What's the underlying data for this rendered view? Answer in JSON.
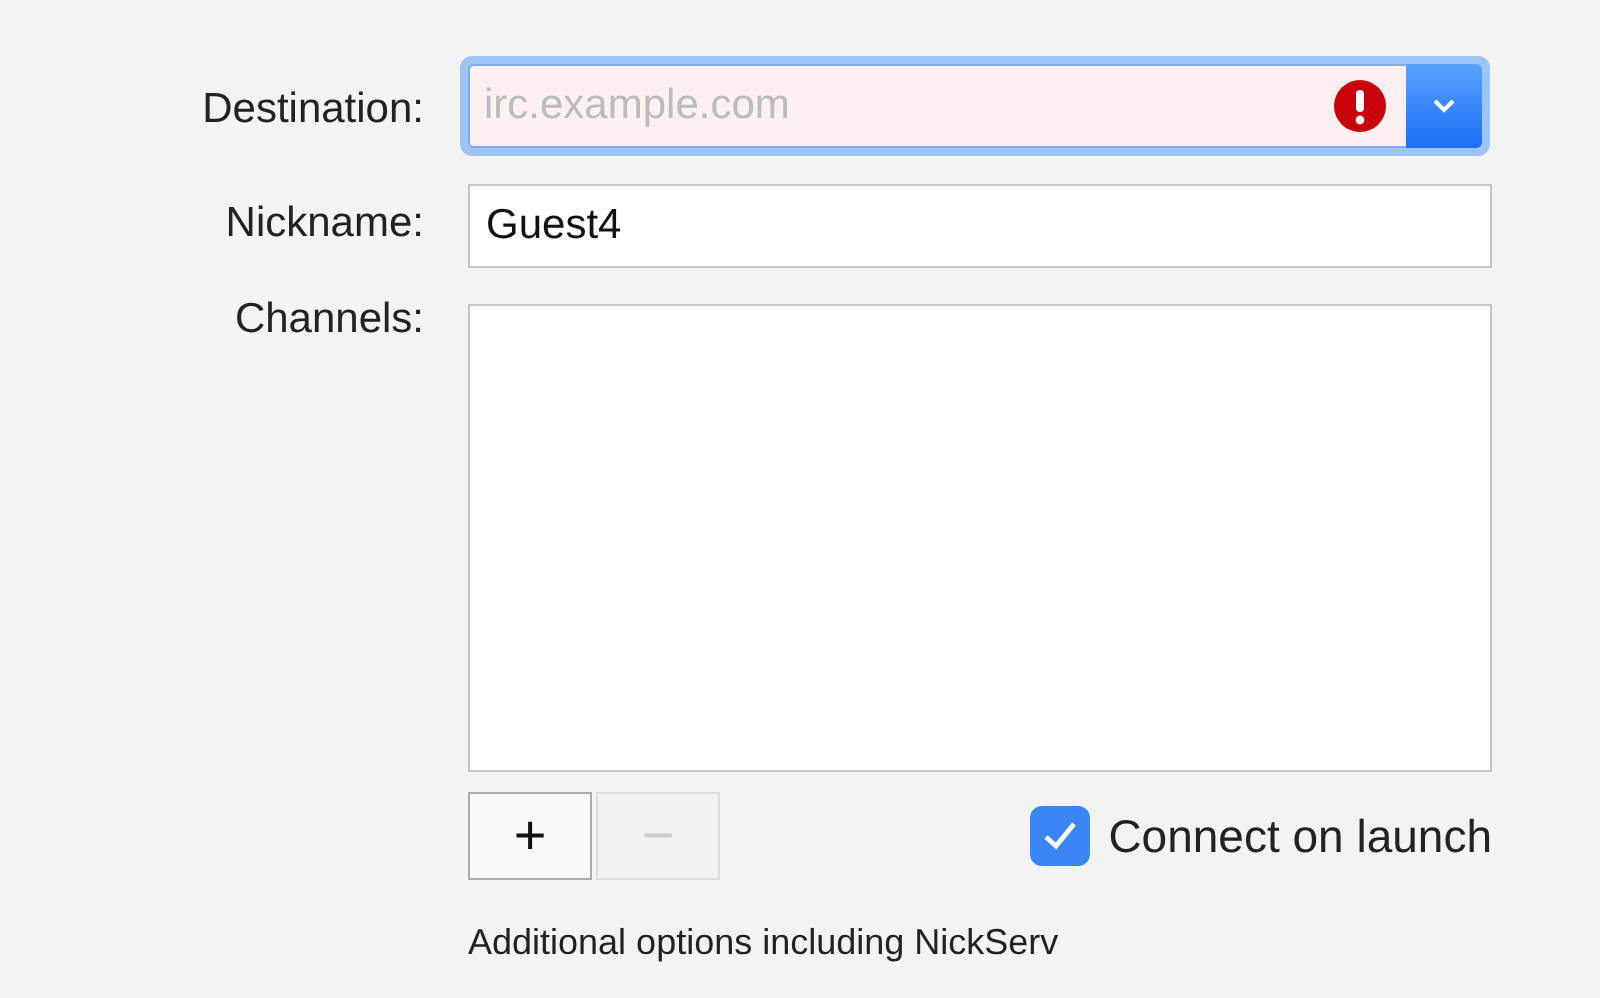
{
  "destination": {
    "label": "Destination:",
    "placeholder": "irc.example.com",
    "error": true,
    "focused": true
  },
  "nickname": {
    "label": "Nickname:",
    "value": "Guest4"
  },
  "channels": {
    "label": "Channels:",
    "buttons": [
      {
        "symbol": "+",
        "disabled": false
      },
      {
        "symbol": "−",
        "disabled": true
      }
    ]
  },
  "connect_on_launch": {
    "label": "Connect on launch",
    "checked": true
  },
  "note": "Additional options including NickServ"
}
